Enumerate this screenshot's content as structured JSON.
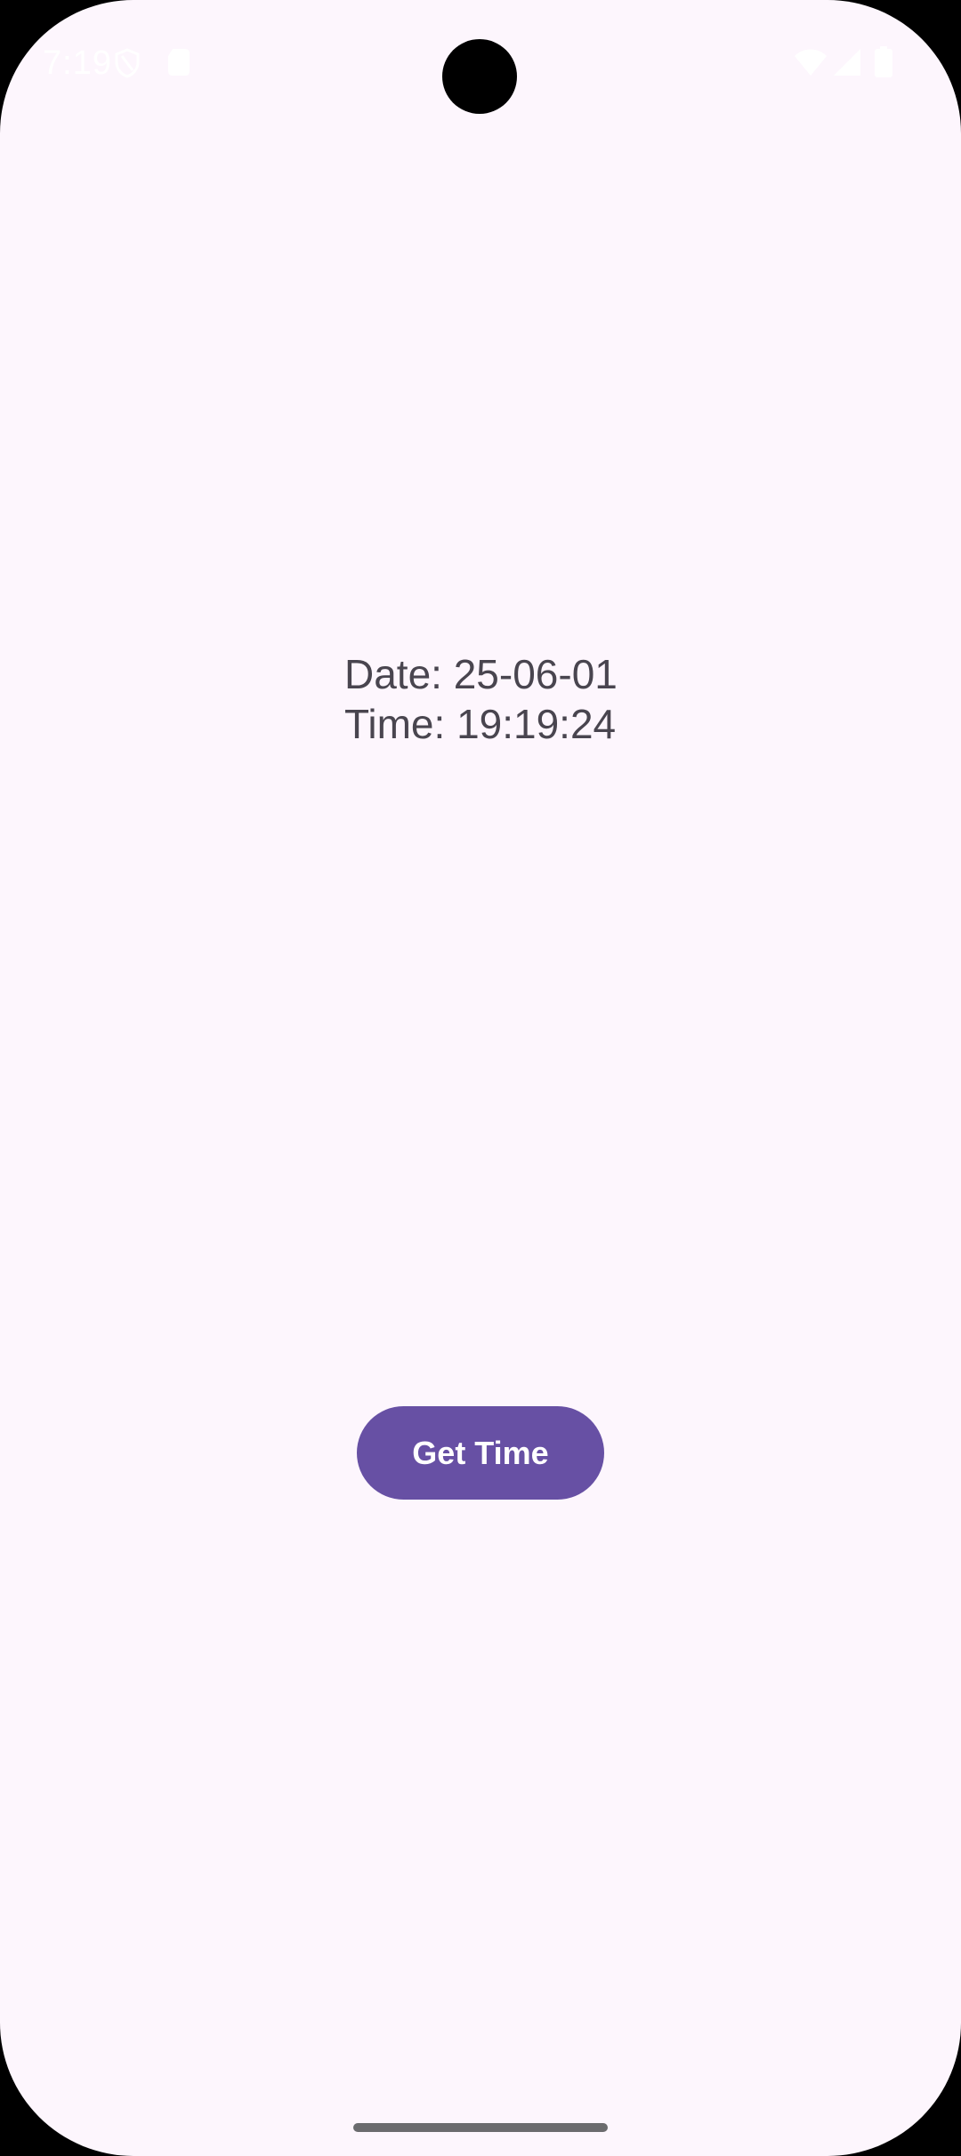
{
  "status_bar": {
    "time": "7:19",
    "icons": [
      "shield-icon",
      "sim-card-icon",
      "wifi-icon",
      "signal-icon",
      "battery-icon"
    ],
    "icon_color": "#ffffff"
  },
  "main": {
    "date_line": "Date: 25-06-01",
    "time_line": "Time: 19:19:24",
    "button_label": "Get Time"
  },
  "colors": {
    "background": "#fdf6fd",
    "text": "#49454f",
    "button": "#6750a4",
    "button_text": "#ffffff"
  }
}
